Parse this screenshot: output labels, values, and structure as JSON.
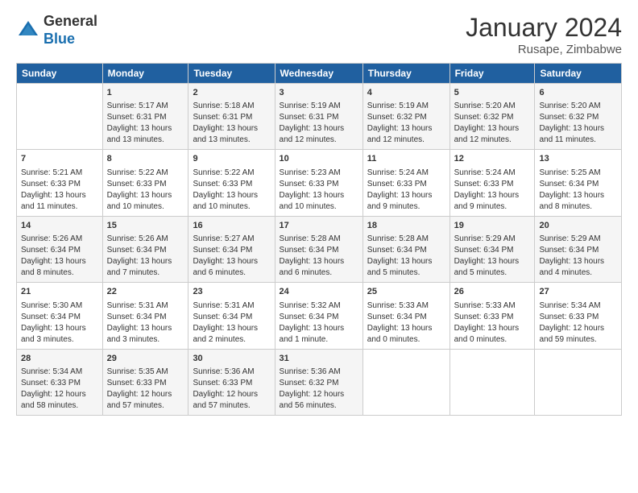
{
  "header": {
    "logo_general": "General",
    "logo_blue": "Blue",
    "month_title": "January 2024",
    "location": "Rusape, Zimbabwe"
  },
  "columns": [
    "Sunday",
    "Monday",
    "Tuesday",
    "Wednesday",
    "Thursday",
    "Friday",
    "Saturday"
  ],
  "weeks": [
    [
      {
        "day": "",
        "sunrise": "",
        "sunset": "",
        "daylight": ""
      },
      {
        "day": "1",
        "sunrise": "Sunrise: 5:17 AM",
        "sunset": "Sunset: 6:31 PM",
        "daylight": "Daylight: 13 hours and 13 minutes."
      },
      {
        "day": "2",
        "sunrise": "Sunrise: 5:18 AM",
        "sunset": "Sunset: 6:31 PM",
        "daylight": "Daylight: 13 hours and 13 minutes."
      },
      {
        "day": "3",
        "sunrise": "Sunrise: 5:19 AM",
        "sunset": "Sunset: 6:31 PM",
        "daylight": "Daylight: 13 hours and 12 minutes."
      },
      {
        "day": "4",
        "sunrise": "Sunrise: 5:19 AM",
        "sunset": "Sunset: 6:32 PM",
        "daylight": "Daylight: 13 hours and 12 minutes."
      },
      {
        "day": "5",
        "sunrise": "Sunrise: 5:20 AM",
        "sunset": "Sunset: 6:32 PM",
        "daylight": "Daylight: 13 hours and 12 minutes."
      },
      {
        "day": "6",
        "sunrise": "Sunrise: 5:20 AM",
        "sunset": "Sunset: 6:32 PM",
        "daylight": "Daylight: 13 hours and 11 minutes."
      }
    ],
    [
      {
        "day": "7",
        "sunrise": "Sunrise: 5:21 AM",
        "sunset": "Sunset: 6:33 PM",
        "daylight": "Daylight: 13 hours and 11 minutes."
      },
      {
        "day": "8",
        "sunrise": "Sunrise: 5:22 AM",
        "sunset": "Sunset: 6:33 PM",
        "daylight": "Daylight: 13 hours and 10 minutes."
      },
      {
        "day": "9",
        "sunrise": "Sunrise: 5:22 AM",
        "sunset": "Sunset: 6:33 PM",
        "daylight": "Daylight: 13 hours and 10 minutes."
      },
      {
        "day": "10",
        "sunrise": "Sunrise: 5:23 AM",
        "sunset": "Sunset: 6:33 PM",
        "daylight": "Daylight: 13 hours and 10 minutes."
      },
      {
        "day": "11",
        "sunrise": "Sunrise: 5:24 AM",
        "sunset": "Sunset: 6:33 PM",
        "daylight": "Daylight: 13 hours and 9 minutes."
      },
      {
        "day": "12",
        "sunrise": "Sunrise: 5:24 AM",
        "sunset": "Sunset: 6:33 PM",
        "daylight": "Daylight: 13 hours and 9 minutes."
      },
      {
        "day": "13",
        "sunrise": "Sunrise: 5:25 AM",
        "sunset": "Sunset: 6:34 PM",
        "daylight": "Daylight: 13 hours and 8 minutes."
      }
    ],
    [
      {
        "day": "14",
        "sunrise": "Sunrise: 5:26 AM",
        "sunset": "Sunset: 6:34 PM",
        "daylight": "Daylight: 13 hours and 8 minutes."
      },
      {
        "day": "15",
        "sunrise": "Sunrise: 5:26 AM",
        "sunset": "Sunset: 6:34 PM",
        "daylight": "Daylight: 13 hours and 7 minutes."
      },
      {
        "day": "16",
        "sunrise": "Sunrise: 5:27 AM",
        "sunset": "Sunset: 6:34 PM",
        "daylight": "Daylight: 13 hours and 6 minutes."
      },
      {
        "day": "17",
        "sunrise": "Sunrise: 5:28 AM",
        "sunset": "Sunset: 6:34 PM",
        "daylight": "Daylight: 13 hours and 6 minutes."
      },
      {
        "day": "18",
        "sunrise": "Sunrise: 5:28 AM",
        "sunset": "Sunset: 6:34 PM",
        "daylight": "Daylight: 13 hours and 5 minutes."
      },
      {
        "day": "19",
        "sunrise": "Sunrise: 5:29 AM",
        "sunset": "Sunset: 6:34 PM",
        "daylight": "Daylight: 13 hours and 5 minutes."
      },
      {
        "day": "20",
        "sunrise": "Sunrise: 5:29 AM",
        "sunset": "Sunset: 6:34 PM",
        "daylight": "Daylight: 13 hours and 4 minutes."
      }
    ],
    [
      {
        "day": "21",
        "sunrise": "Sunrise: 5:30 AM",
        "sunset": "Sunset: 6:34 PM",
        "daylight": "Daylight: 13 hours and 3 minutes."
      },
      {
        "day": "22",
        "sunrise": "Sunrise: 5:31 AM",
        "sunset": "Sunset: 6:34 PM",
        "daylight": "Daylight: 13 hours and 3 minutes."
      },
      {
        "day": "23",
        "sunrise": "Sunrise: 5:31 AM",
        "sunset": "Sunset: 6:34 PM",
        "daylight": "Daylight: 13 hours and 2 minutes."
      },
      {
        "day": "24",
        "sunrise": "Sunrise: 5:32 AM",
        "sunset": "Sunset: 6:34 PM",
        "daylight": "Daylight: 13 hours and 1 minute."
      },
      {
        "day": "25",
        "sunrise": "Sunrise: 5:33 AM",
        "sunset": "Sunset: 6:34 PM",
        "daylight": "Daylight: 13 hours and 0 minutes."
      },
      {
        "day": "26",
        "sunrise": "Sunrise: 5:33 AM",
        "sunset": "Sunset: 6:33 PM",
        "daylight": "Daylight: 13 hours and 0 minutes."
      },
      {
        "day": "27",
        "sunrise": "Sunrise: 5:34 AM",
        "sunset": "Sunset: 6:33 PM",
        "daylight": "Daylight: 12 hours and 59 minutes."
      }
    ],
    [
      {
        "day": "28",
        "sunrise": "Sunrise: 5:34 AM",
        "sunset": "Sunset: 6:33 PM",
        "daylight": "Daylight: 12 hours and 58 minutes."
      },
      {
        "day": "29",
        "sunrise": "Sunrise: 5:35 AM",
        "sunset": "Sunset: 6:33 PM",
        "daylight": "Daylight: 12 hours and 57 minutes."
      },
      {
        "day": "30",
        "sunrise": "Sunrise: 5:36 AM",
        "sunset": "Sunset: 6:33 PM",
        "daylight": "Daylight: 12 hours and 57 minutes."
      },
      {
        "day": "31",
        "sunrise": "Sunrise: 5:36 AM",
        "sunset": "Sunset: 6:32 PM",
        "daylight": "Daylight: 12 hours and 56 minutes."
      },
      {
        "day": "",
        "sunrise": "",
        "sunset": "",
        "daylight": ""
      },
      {
        "day": "",
        "sunrise": "",
        "sunset": "",
        "daylight": ""
      },
      {
        "day": "",
        "sunrise": "",
        "sunset": "",
        "daylight": ""
      }
    ]
  ]
}
